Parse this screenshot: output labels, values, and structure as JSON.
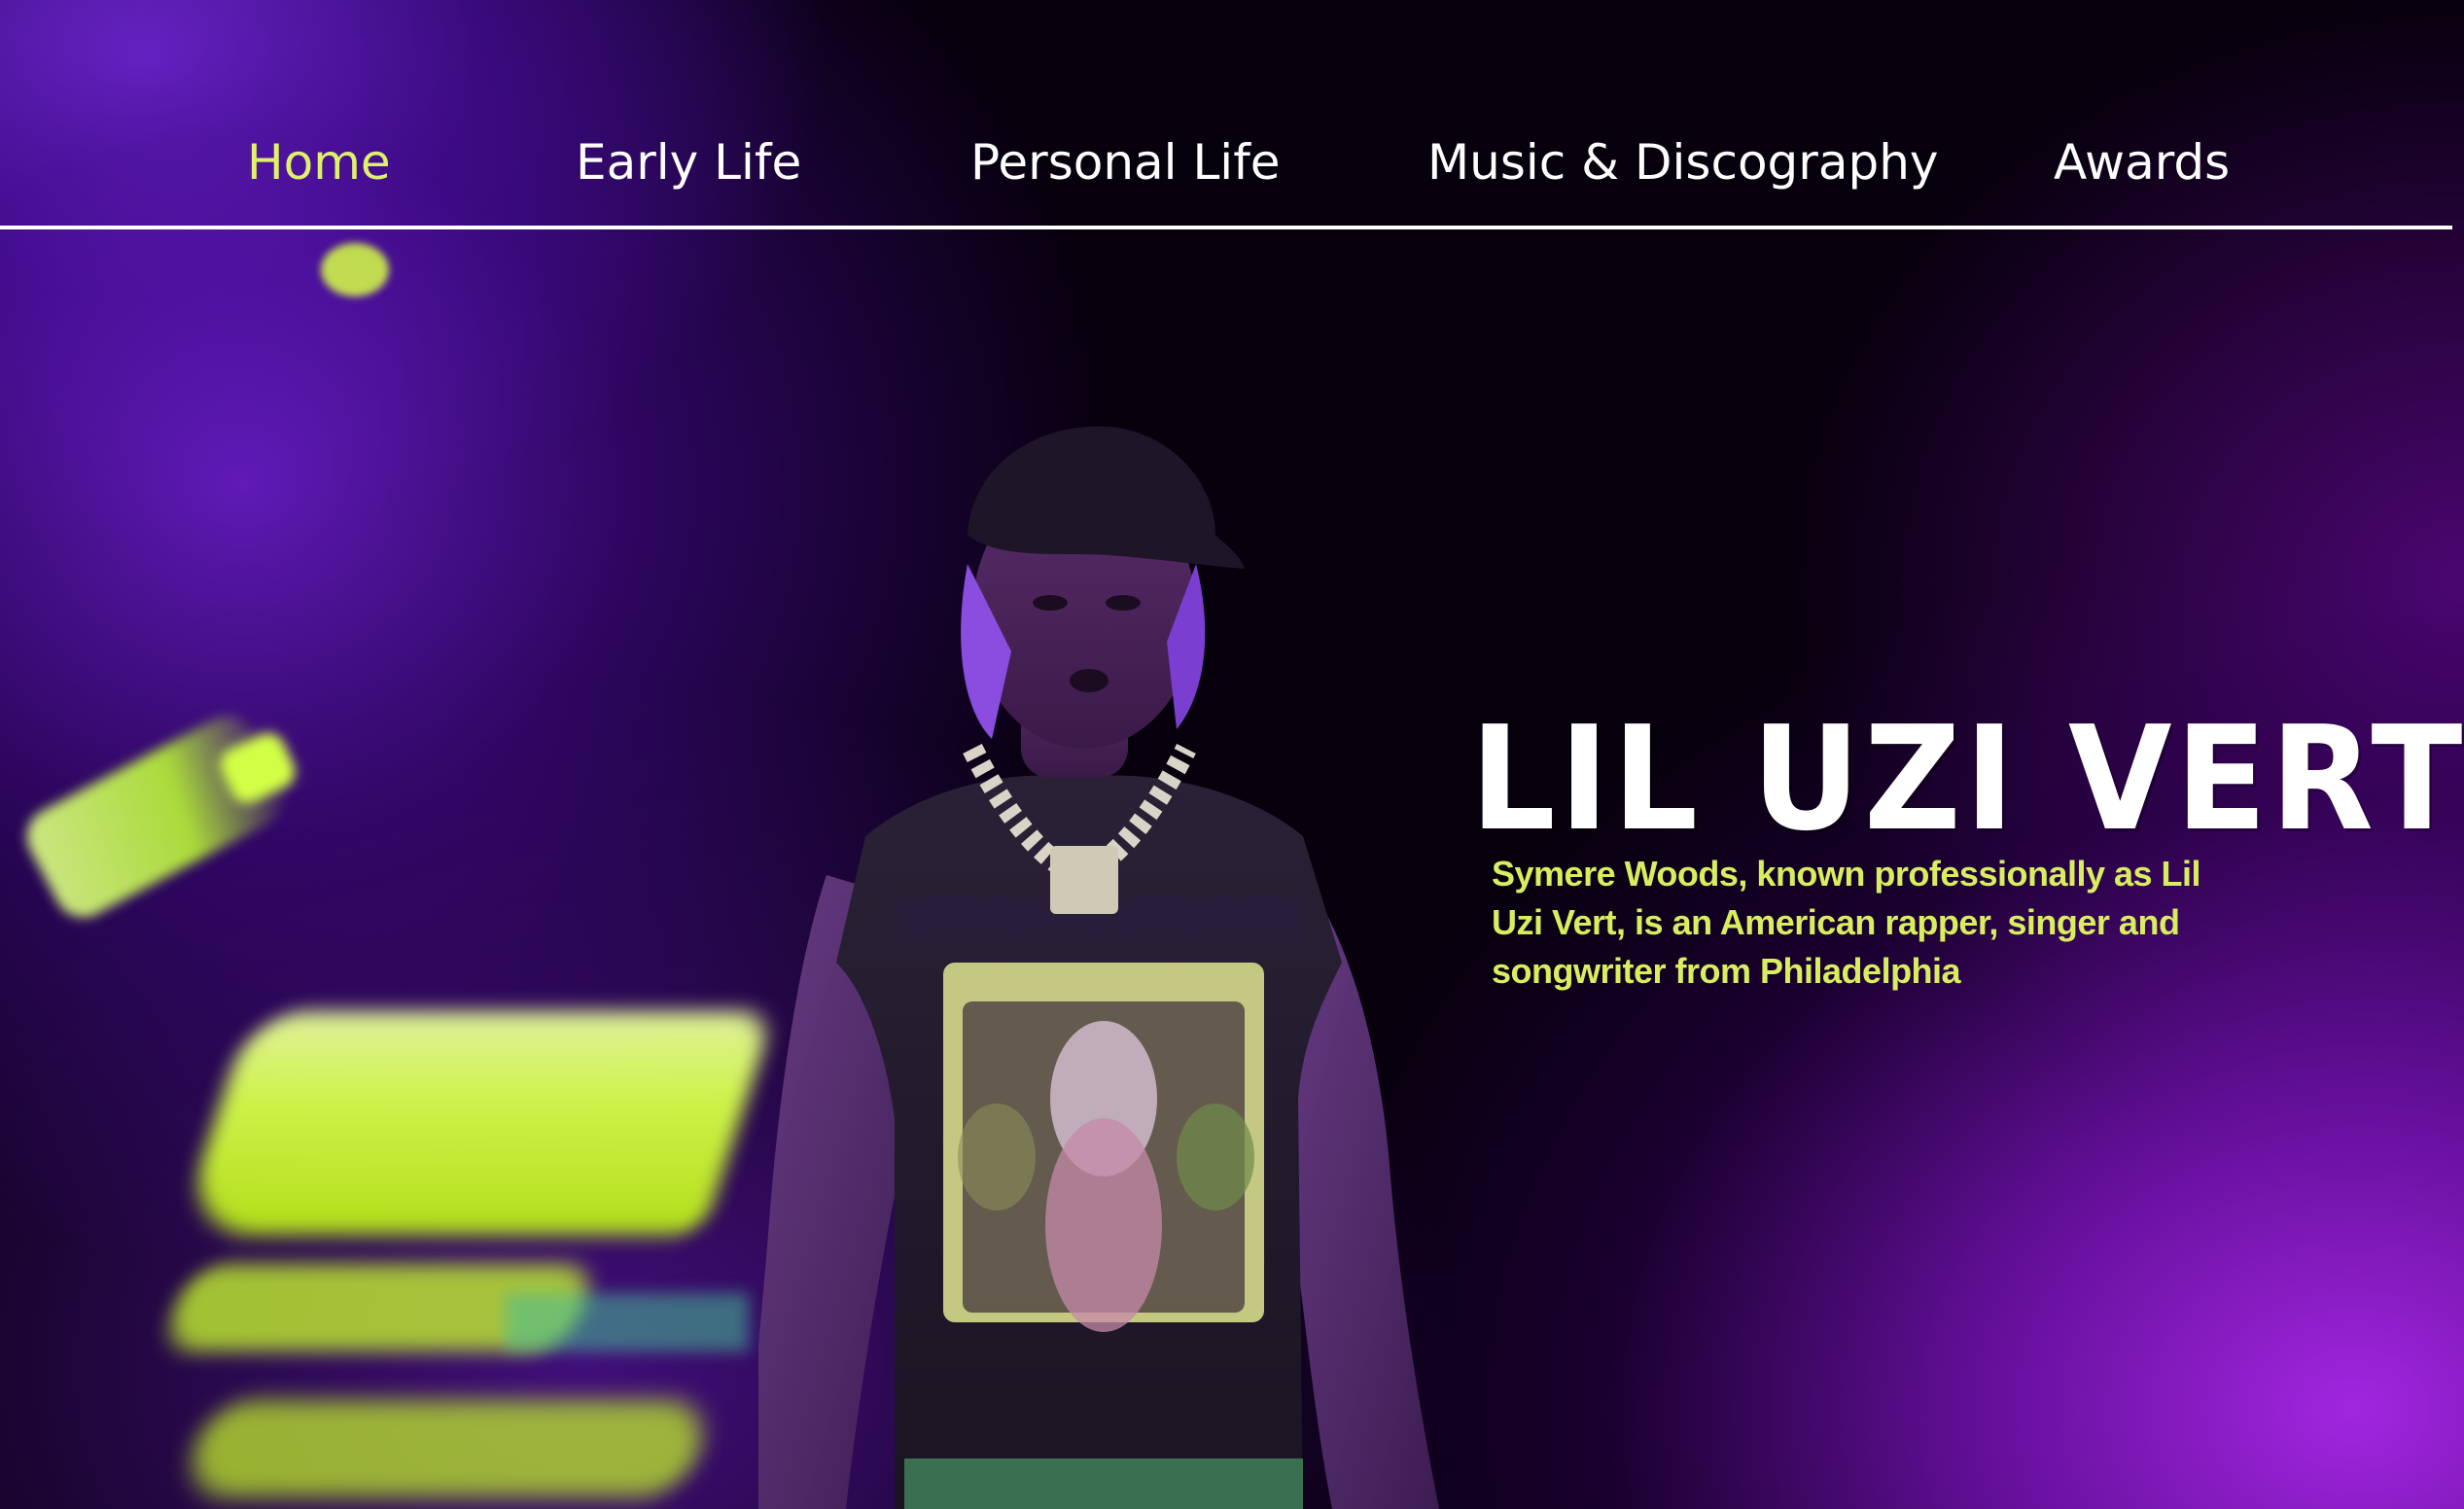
{
  "nav": {
    "items": [
      {
        "label": "Home",
        "active": true
      },
      {
        "label": "Early Life",
        "active": false
      },
      {
        "label": "Personal Life",
        "active": false
      },
      {
        "label": "Music & Discography",
        "active": false
      },
      {
        "label": "Awards",
        "active": false
      }
    ]
  },
  "hero": {
    "title": "LIL UZI VERT",
    "description": "Symere Woods, known professionally as Lil Uzi Vert, is an American rapper, singer and songwriter from Philadelphia"
  },
  "colors": {
    "accent_yellow": "#dff06a",
    "text_white": "#ffffff",
    "purple": "#8a1fd6",
    "background": "#000000"
  }
}
